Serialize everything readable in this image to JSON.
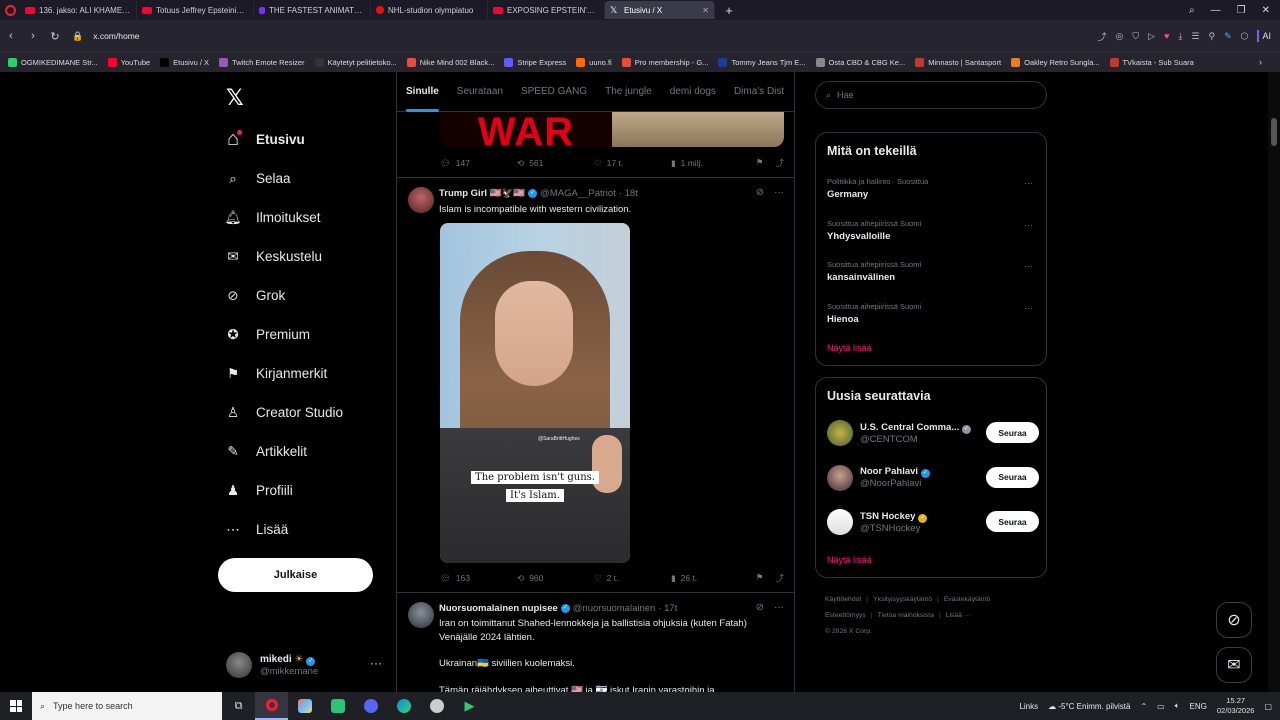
{
  "browser": {
    "tabs": [
      {
        "title": "136. jakso: ALI KHAMENEI",
        "icon": "youtube-icon"
      },
      {
        "title": "Totuus Jeffrey Epsteinin K",
        "icon": "youtube-icon"
      },
      {
        "title": "THE FASTEST ANIMATRONI",
        "icon": "youtube-icon"
      },
      {
        "title": "NHL-studion olympiatuo",
        "icon": "nhl-icon"
      },
      {
        "title": "EXPOSING EPSTEIN'S ZOR",
        "icon": "youtube-icon"
      },
      {
        "title": "Etusivu / X",
        "icon": "x-icon",
        "active": true
      }
    ],
    "url": "x.com/home",
    "ai_label": "AI",
    "bookmarks": [
      {
        "label": "OGMIKEDIMANE Str...",
        "color": "#2ecc71"
      },
      {
        "label": "YouTube",
        "color": "#ff0033"
      },
      {
        "label": "Etusivu / X",
        "color": "#000000"
      },
      {
        "label": "Twitch Emote Resizer",
        "color": "#9b59b6"
      },
      {
        "label": "Käytetyt pelitietoko...",
        "color": "#333333"
      },
      {
        "label": "Nike Mind 002 Black...",
        "color": "#e84c3d"
      },
      {
        "label": "Stripe Express",
        "color": "#635bff"
      },
      {
        "label": "uuno.fi",
        "color": "#ff6a00"
      },
      {
        "label": "Pro membership - G...",
        "color": "#e74c3c"
      },
      {
        "label": "Tommy Jeans Tjm E...",
        "color": "#1f3a93"
      },
      {
        "label": "Osta CBD & CBG Ke...",
        "color": "#888888"
      },
      {
        "label": "Minnasto | Santasport",
        "color": "#c0392b"
      },
      {
        "label": "Oakley Retro Sungla...",
        "color": "#e67e22"
      },
      {
        "label": "TVkaista - Sub Suara",
        "color": "#c0392b"
      }
    ]
  },
  "sidebar": {
    "items": [
      {
        "label": "Etusivu",
        "icon": "home-icon"
      },
      {
        "label": "Selaa",
        "icon": "search-icon"
      },
      {
        "label": "Ilmoitukset",
        "icon": "bell-icon"
      },
      {
        "label": "Keskustelu",
        "icon": "mail-icon"
      },
      {
        "label": "Grok",
        "icon": "grok-icon"
      },
      {
        "label": "Premium",
        "icon": "premium-icon"
      },
      {
        "label": "Kirjanmerkit",
        "icon": "bookmark-icon"
      },
      {
        "label": "Creator Studio",
        "icon": "creator-icon"
      },
      {
        "label": "Artikkelit",
        "icon": "article-icon"
      },
      {
        "label": "Profiili",
        "icon": "profile-icon"
      },
      {
        "label": "Lisää",
        "icon": "more-icon"
      }
    ],
    "post_label": "Julkaise",
    "account": {
      "name": "mikedi",
      "handle": "@mikkemane"
    }
  },
  "timeline": {
    "tabs": [
      "Sinulle",
      "Seurataan",
      "SPEED GANG",
      "The jungle",
      "demi dogs",
      "Dima's Dist"
    ],
    "first_post": {
      "image_text": "WAR",
      "replies": "147",
      "reposts": "561",
      "likes": "17 t.",
      "views": "1 milj."
    },
    "post2": {
      "name": "Trump Girl 🇺🇸🦅🇺🇸",
      "handle": "@MAGA__Patriot",
      "time": "· 18t",
      "text": "Islam is incompatible with western civilization.",
      "video_watermark": "@SaraBrittHughes",
      "caption_line1": "The problem isn't guns.",
      "caption_line2": "It's Islam.",
      "replies": "163",
      "reposts": "960",
      "likes": "2 t.",
      "views": "26 t."
    },
    "post3": {
      "name": "Nuorsuomalainen nupisee",
      "handle": "@nuorsuomalainen",
      "time": "· 17t",
      "line1": "Iran on toimittanut Shahed-lennokkeja ja ballistisia ohjuksia (kuten Fatah)",
      "line2": "Venäjälle 2024 lähtien.",
      "line3": "Ukrainan🇺🇦 siviilien kuolemaksi.",
      "line4": "Tämän räjähdyksen aiheuttivat 🇺🇸 ja 🇮🇱 iskut Iranin varastoihin ja"
    }
  },
  "right": {
    "search_placeholder": "Hae",
    "trends_title": "Mitä on tekeillä",
    "trends": [
      {
        "context": "Politiikka ja hallinto · Suosittua",
        "topic": "Germany"
      },
      {
        "context": "Suosittua aihepiirissä Suomi",
        "topic": "Yhdysvalloille"
      },
      {
        "context": "Suosittua aihepiirissä Suomi",
        "topic": "kansainvälinen"
      },
      {
        "context": "Suosittua aihepiirissä Suomi",
        "topic": "Hienoa"
      }
    ],
    "show_more": "Näytä lisää",
    "follow_title": "Uusia seurattavia",
    "follow": [
      {
        "name": "U.S. Central Comma...",
        "handle": "@CENTCOM",
        "badge": "gray",
        "button": "Seuraa"
      },
      {
        "name": "Noor Pahlavi",
        "handle": "@NoorPahlavi",
        "badge": "blue",
        "button": "Seuraa"
      },
      {
        "name": "TSN Hockey",
        "handle": "@TSNHockey",
        "badge": "gold",
        "button": "Seuraa"
      }
    ],
    "footer": [
      "Käyttöehdot",
      "Yksityisyyskäytäntö",
      "Evästekäytäntö",
      "Esteettömyys",
      "Tietoa mainoksista",
      "Lisää ···",
      "© 2026 X Corp."
    ]
  },
  "taskbar": {
    "search_placeholder": "Type here to search",
    "links_label": "Links",
    "weather": "-5°C  Enimm. pilvistä",
    "lang": "ENG",
    "time": "15.27",
    "date": "02/03/2026"
  },
  "colors": {
    "accent": "#1d9bf0",
    "pink": "#f91880",
    "tab_bg": "#1c1a26",
    "war_red": "#e40014"
  }
}
